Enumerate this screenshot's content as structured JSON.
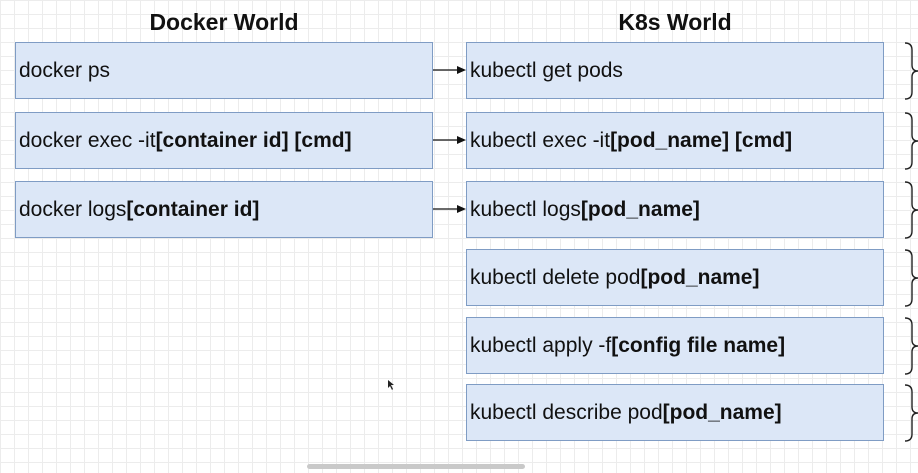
{
  "headers": {
    "docker": "Docker World",
    "k8s": "K8s World"
  },
  "docker_commands": [
    {
      "plain": "docker ps",
      "bold": ""
    },
    {
      "plain": "docker exec -it ",
      "bold": "[container id] [cmd]"
    },
    {
      "plain": "docker logs ",
      "bold": "[container id]"
    }
  ],
  "k8s_commands": [
    {
      "plain": "kubectl get pods",
      "bold": ""
    },
    {
      "plain": "kubectl exec -it ",
      "bold": "[pod_name] [cmd]"
    },
    {
      "plain": "kubectl logs ",
      "bold": "[pod_name]"
    },
    {
      "plain": "kubectl delete pod ",
      "bold": "[pod_name]"
    },
    {
      "plain": "kubectl apply -f ",
      "bold": "[config file name]"
    },
    {
      "plain": "kubectl describe pod ",
      "bold": "[pod_name]"
    }
  ],
  "colors": {
    "box_fill": "#dce7f7",
    "box_border": "#7f9cc4",
    "arrow": "#111111"
  }
}
